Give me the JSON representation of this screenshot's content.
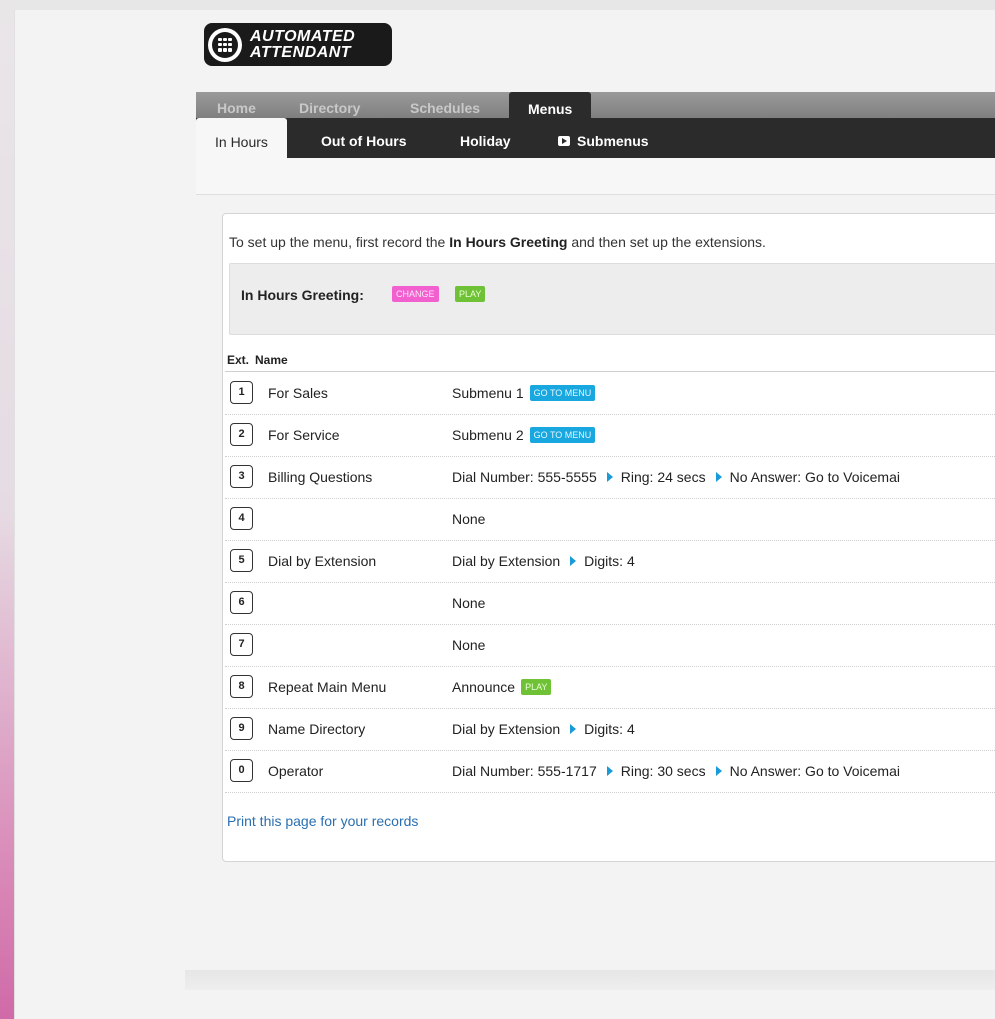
{
  "logo": {
    "line1": "AUTOMATED",
    "line2": "ATTENDANT"
  },
  "nav": {
    "tabs": [
      {
        "label": "Home"
      },
      {
        "label": "Directory"
      },
      {
        "label": "Schedules"
      },
      {
        "label": "Menus"
      }
    ],
    "active": "Menus"
  },
  "subnav": {
    "tabs": [
      {
        "label": "In Hours"
      },
      {
        "label": "Out of Hours"
      },
      {
        "label": "Holiday"
      },
      {
        "label": "Submenus"
      }
    ],
    "active": "In Hours"
  },
  "intro": {
    "before": "To set up the menu, first record the ",
    "bold": "In Hours Greeting",
    "after": " and then set up the extensions."
  },
  "greeting": {
    "label": "In Hours Greeting:",
    "change_label": "CHANGE",
    "play_label": "PLAY"
  },
  "table": {
    "headers": {
      "ext": "Ext.",
      "name": "Name"
    },
    "rows": [
      {
        "ext": "1",
        "name": "For Sales",
        "action": "Submenu 1",
        "button": "GO TO MENU"
      },
      {
        "ext": "2",
        "name": "For Service",
        "action": "Submenu 2",
        "button": "GO TO MENU"
      },
      {
        "ext": "3",
        "name": "Billing Questions",
        "action": "Dial Number: 555-5555",
        "ring": "Ring: 24 secs",
        "noanswer": "No Answer: Go to Voicemai"
      },
      {
        "ext": "4",
        "name": "",
        "action": "None"
      },
      {
        "ext": "5",
        "name": "Dial by Extension",
        "action": "Dial by Extension",
        "digits": "Digits: 4"
      },
      {
        "ext": "6",
        "name": "",
        "action": "None"
      },
      {
        "ext": "7",
        "name": "",
        "action": "None"
      },
      {
        "ext": "8",
        "name": "Repeat Main Menu",
        "action": "Announce",
        "button": "PLAY"
      },
      {
        "ext": "9",
        "name": "Name Directory",
        "action": "Dial by Extension",
        "digits": "Digits: 4"
      },
      {
        "ext": "0",
        "name": "Operator",
        "action": "Dial Number: 555-1717",
        "ring": "Ring: 30 secs",
        "noanswer": "No Answer: Go to Voicemai"
      }
    ]
  },
  "print_link": "Print this page for your records",
  "colors": {
    "accent_blue": "#19a7e0",
    "play_green": "#6fc235",
    "change_pink": "#f25fcf",
    "nav_dark": "#2b2b2b",
    "link_blue": "#2a6fb0"
  }
}
